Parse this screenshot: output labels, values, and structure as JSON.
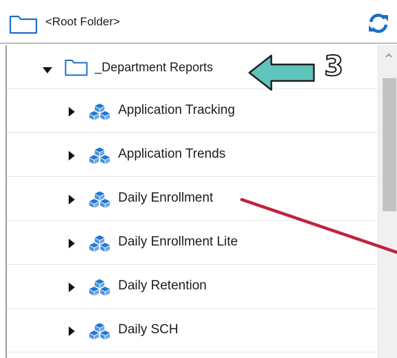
{
  "root": {
    "label": "<Root Folder>"
  },
  "tree": {
    "parent": {
      "label": "_Department Reports",
      "expanded": true
    },
    "children": [
      {
        "label": "Application Tracking"
      },
      {
        "label": "Application Trends"
      },
      {
        "label": "Daily Enrollment"
      },
      {
        "label": "Daily Enrollment Lite"
      },
      {
        "label": "Daily Retention"
      },
      {
        "label": "Daily SCH"
      }
    ]
  },
  "annotation": {
    "number": "3",
    "arrow_color": "#5fc4bb",
    "line_color": "#c0223f"
  },
  "colors": {
    "folder_outline": "#1b6fc8",
    "cube_icon": "#1e78d4",
    "refresh_icon": "#1b6fc8"
  }
}
